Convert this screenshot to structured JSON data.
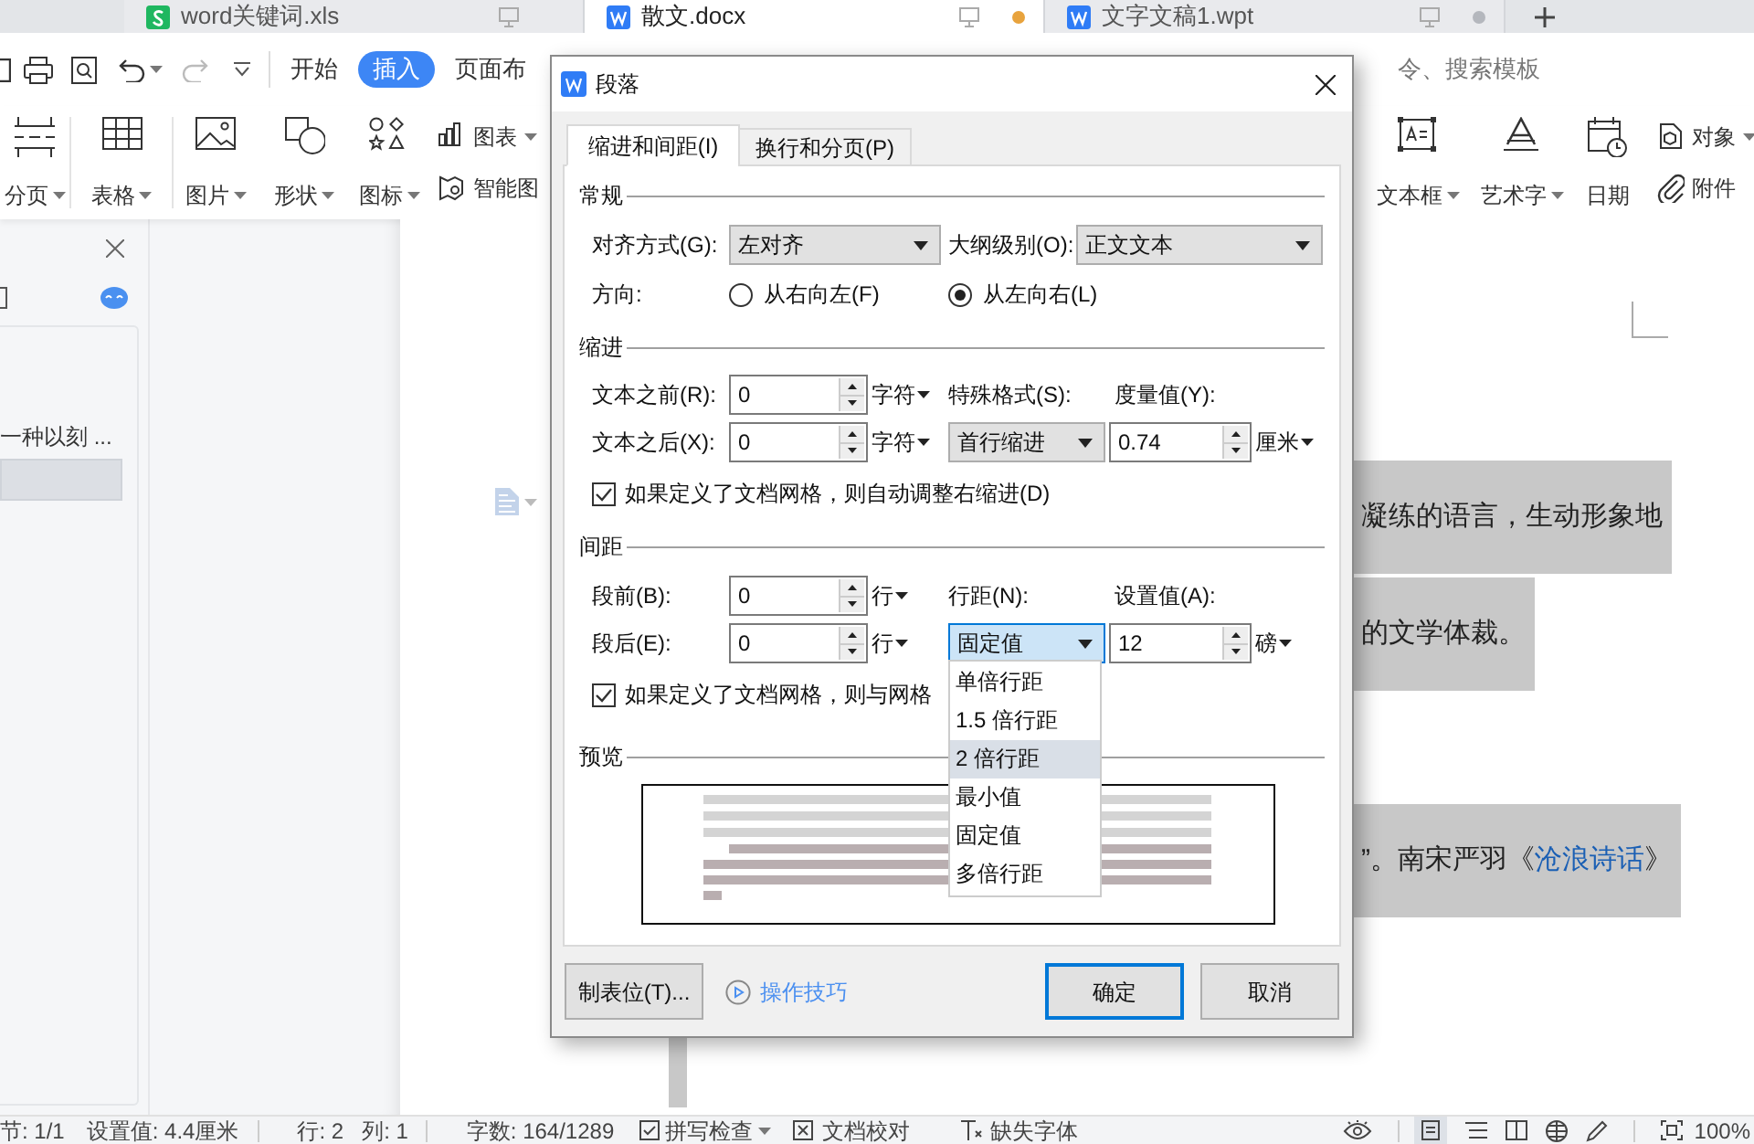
{
  "app_tabs": [
    {
      "label": "word关键词.xls",
      "kind": "sheet",
      "selected": false
    },
    {
      "label": "散文.docx",
      "kind": "doc",
      "selected": true,
      "color": "#e8a33d"
    },
    {
      "label": "文字文稿1.wpt",
      "kind": "doc",
      "selected": false,
      "color": "#b4b7bd"
    }
  ],
  "menu_tabs": [
    {
      "label": "开始",
      "selected": false
    },
    {
      "label": "插入",
      "selected": true
    },
    {
      "label": "页面布",
      "selected": false
    }
  ],
  "search": {
    "placeholder": "令、搜索模板"
  },
  "ribbon_left": [
    {
      "label": "分页",
      "kind": "large",
      "dropdown": true
    },
    {
      "label": "表格",
      "kind": "large",
      "dropdown": true
    },
    {
      "label": "图片",
      "kind": "large",
      "dropdown": true
    },
    {
      "label": "形状",
      "kind": "large",
      "dropdown": true
    },
    {
      "label": "图标",
      "kind": "large",
      "dropdown": true
    },
    {
      "label": "图表",
      "kind": "small",
      "dropdown": true
    },
    {
      "label": "智能图",
      "kind": "small",
      "dropdown": false
    }
  ],
  "ribbon_right": [
    {
      "label": "文本框",
      "kind": "large",
      "dropdown": true
    },
    {
      "label": "艺术字",
      "kind": "large",
      "dropdown": true
    },
    {
      "label": "日期",
      "kind": "large",
      "dropdown": false
    },
    {
      "label": "对象",
      "kind": "small",
      "dropdown": true
    },
    {
      "label": "附件",
      "kind": "small",
      "dropdown": false
    }
  ],
  "left_pane": {
    "entry": "一种以刻 ..."
  },
  "document": {
    "paragraphs": [
      {
        "text": "凝练的语言，生动形象地"
      },
      {
        "text": "的文学体裁。"
      },
      {
        "text": "”。南宋严羽《",
        "link": "沧浪诗话",
        "tail": "》"
      }
    ]
  },
  "dialog": {
    "title": "段落",
    "tabs": [
      {
        "label": "缩进和间距(I)",
        "selected": true
      },
      {
        "label": "换行和分页(P)",
        "selected": false
      }
    ],
    "general": {
      "heading": "常规",
      "alignment": {
        "label": "对齐方式(G):",
        "value": "左对齐"
      },
      "outline": {
        "label": "大纲级别(O):",
        "value": "正文文本"
      },
      "direction": {
        "label": "方向:",
        "options": [
          {
            "label": "从右向左(F)",
            "selected": false
          },
          {
            "label": "从左向右(L)",
            "selected": true
          }
        ]
      }
    },
    "indent": {
      "heading": "缩进",
      "before": {
        "label": "文本之前(R):",
        "value": "0",
        "unit": "字符"
      },
      "after": {
        "label": "文本之后(X):",
        "value": "0",
        "unit": "字符"
      },
      "special": {
        "label": "特殊格式(S):",
        "value": "首行缩进"
      },
      "measure": {
        "label": "度量值(Y):",
        "value": "0.74",
        "unit": "厘米"
      },
      "grid": {
        "label": "如果定义了文档网格，则自动调整右缩进(D)",
        "checked": true
      }
    },
    "spacing": {
      "heading": "间距",
      "before": {
        "label": "段前(B):",
        "value": "0",
        "unit": "行"
      },
      "after": {
        "label": "段后(E):",
        "value": "0",
        "unit": "行"
      },
      "line": {
        "label": "行距(N):",
        "value": "固定值",
        "expanded": true
      },
      "setting": {
        "label": "设置值(A):",
        "value": "12",
        "unit": "磅"
      },
      "grid": {
        "label": "如果定义了文档网格，则与网格",
        "checked": true
      }
    },
    "preview": {
      "heading": "预览"
    },
    "tab_stops_button": "制表位(T)...",
    "tips_link": "操作技巧",
    "ok_button": "确定",
    "cancel_button": "取消"
  },
  "line_spacing_menu": [
    {
      "label": "单倍行距",
      "selected": false
    },
    {
      "label": "1.5 倍行距",
      "selected": false
    },
    {
      "label": "2 倍行距",
      "selected": true
    },
    {
      "label": "最小值",
      "selected": false
    },
    {
      "label": "固定值",
      "selected": false
    },
    {
      "label": "多倍行距",
      "selected": false
    }
  ],
  "status_bar": {
    "items": [
      "节: 1/1",
      "设置值: 4.4厘米",
      "行: 2",
      "列: 1",
      "字数: 164/1289"
    ],
    "spell_check": "拼写检查",
    "doc_check": "文档校对",
    "missing_font": "缺失字体",
    "zoom": "100%"
  }
}
